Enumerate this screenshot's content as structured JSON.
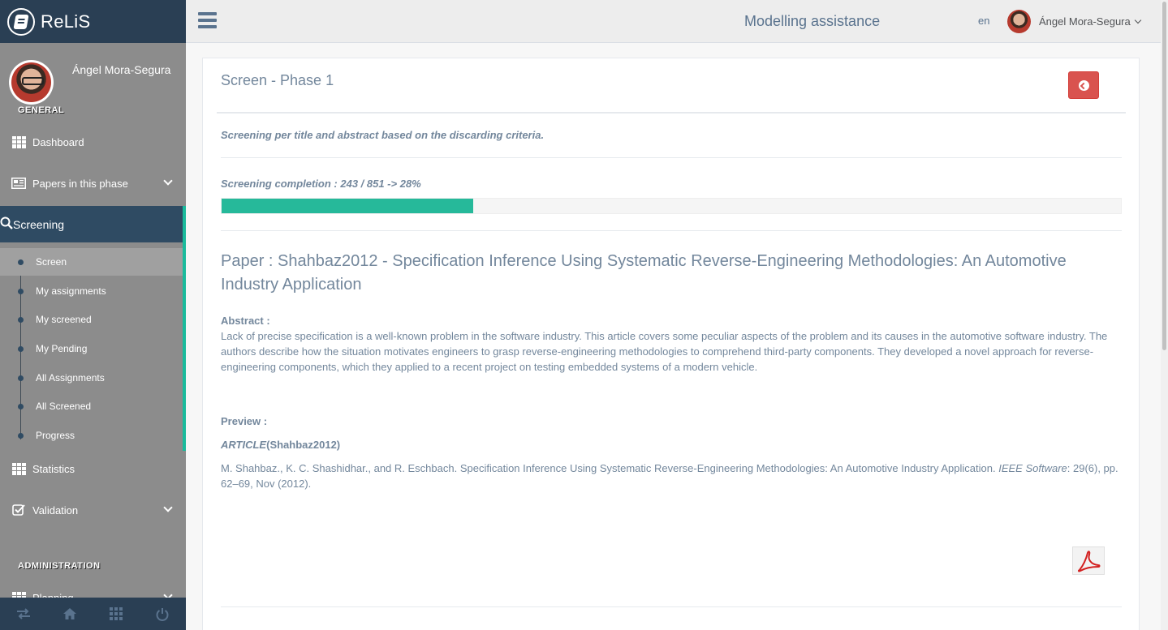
{
  "brand": {
    "name": "ReLiS"
  },
  "profile": {
    "name": "Ángel Mora-Segura"
  },
  "sidebar": {
    "section_general": "GENERAL",
    "section_admin": "ADMINISTRATION",
    "items": [
      {
        "label": "Dashboard",
        "icon": "grid-icon"
      },
      {
        "label": "Papers in this phase",
        "icon": "newspaper-icon"
      },
      {
        "label": "Screening",
        "icon": "search-icon"
      },
      {
        "label": "Statistics",
        "icon": "grid-icon"
      },
      {
        "label": "Validation",
        "icon": "check-square-icon"
      },
      {
        "label": "Planning",
        "icon": "grid-icon"
      }
    ],
    "screening_sub": [
      {
        "label": "Screen"
      },
      {
        "label": "My assignments"
      },
      {
        "label": "My screened"
      },
      {
        "label": "My Pending"
      },
      {
        "label": "All Assignments"
      },
      {
        "label": "All Screened"
      },
      {
        "label": "Progress"
      }
    ],
    "footer_icons": [
      "exchange-icon",
      "home-icon",
      "grid-icon",
      "power-icon"
    ]
  },
  "topnav": {
    "title": "Modelling assistance",
    "lang": "en",
    "user": "Ángel Mora-Segura"
  },
  "panel": {
    "title": "Screen - Phase 1",
    "description": "Screening per title and abstract based on the discarding criteria.",
    "completion_text": "Screening completion : 243 / 851 -> 28%",
    "progress_fraction": 0.28,
    "paper_title": "Paper : Shahbaz2012 - Specification Inference Using Systematic Reverse-Engineering Methodologies: An Automotive Industry Application",
    "abstract_label": "Abstract :",
    "abstract_text": "Lack of precise specification is a well-known problem in the software industry. This article covers some peculiar aspects of the problem and its causes in the automotive software industry. The authors describe how the situation motivates engineers to grasp reverse-engineering methodologies to comprehend third-party components. They developed a novel approach for reverse-engineering components, which they applied to a recent project on testing embedded systems of a modern vehicle.",
    "preview_label": "Preview :",
    "article_type": "ARTICLE",
    "article_key": "(Shahbaz2012)",
    "citation_main": "M. Shahbaz., K. C. Shashidhar., and R. Eschbach. Specification Inference Using Systematic Reverse-Engineering Methodologies: An Automotive Industry Application.",
    "citation_journal": "IEEE Software",
    "citation_rest": ": 29(6), pp. 62–69, Nov (2012)."
  },
  "colors": {
    "sidebar_dark": "#2a3f54",
    "accent_green": "#26b99a",
    "danger": "#d9534f"
  }
}
